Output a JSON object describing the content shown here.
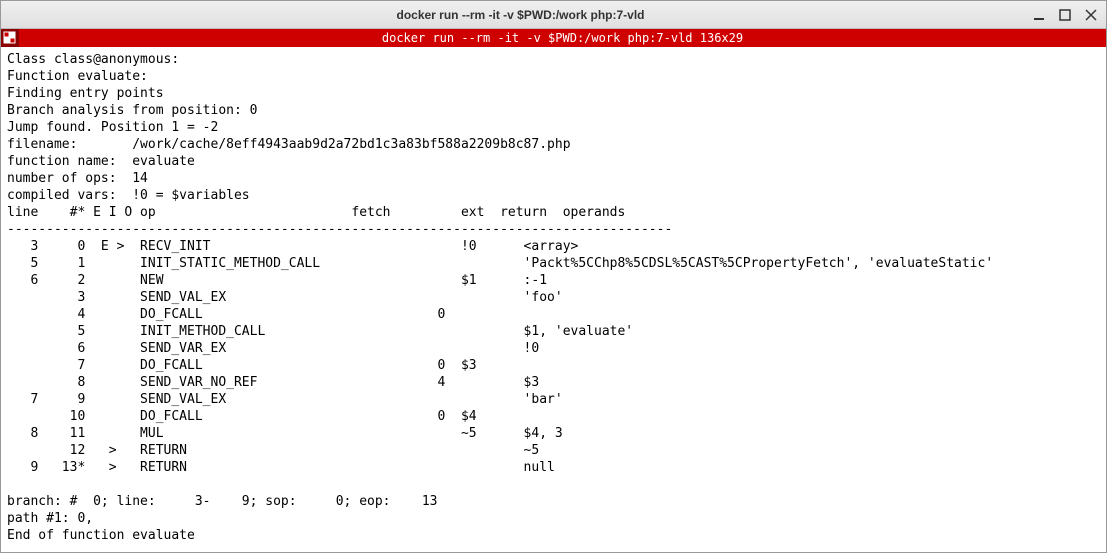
{
  "window": {
    "title": "docker run --rm -it -v $PWD:/work php:7-vld"
  },
  "redbar": {
    "title": "docker run --rm -it -v $PWD:/work php:7-vld 136x29"
  },
  "preamble": {
    "class_line": "Class class@anonymous:",
    "function_line": "Function evaluate:",
    "finding": "Finding entry points",
    "branch_analysis": "Branch analysis from position: 0",
    "jump_found": "Jump found. Position 1 = -2",
    "filename_label": "filename:",
    "filename_value": "/work/cache/8eff4943aab9d2a72bd1c3a83bf588a2209b8c87.php",
    "fn_name_label": "function name:",
    "fn_name_value": "evaluate",
    "num_ops_label": "number of ops:",
    "num_ops_value": "14",
    "compiled_vars_label": "compiled vars:",
    "compiled_vars_value": "!0 = $variables"
  },
  "header": {
    "line": "line",
    "num_eio": "#* E I O",
    "op": "op",
    "fetch": "fetch",
    "ext": "ext",
    "return": "return",
    "operands": "operands"
  },
  "dashes": "-------------------------------------------------------------------------------------",
  "rows": [
    {
      "line": "3",
      "idx": "0",
      "eio": "E >",
      "op": "RECV_INIT",
      "fetch": "",
      "ext": "",
      "ret": "!0",
      "operands": "<array>"
    },
    {
      "line": "5",
      "idx": "1",
      "eio": "",
      "op": "INIT_STATIC_METHOD_CALL",
      "fetch": "",
      "ext": "",
      "ret": "",
      "operands": "'Packt%5CChp8%5CDSL%5CAST%5CPropertyFetch', 'evaluateStatic'"
    },
    {
      "line": "6",
      "idx": "2",
      "eio": "",
      "op": "NEW",
      "fetch": "",
      "ext": "",
      "ret": "$1",
      "operands": ":-1"
    },
    {
      "line": "",
      "idx": "3",
      "eio": "",
      "op": "SEND_VAL_EX",
      "fetch": "",
      "ext": "",
      "ret": "",
      "operands": "'foo'"
    },
    {
      "line": "",
      "idx": "4",
      "eio": "",
      "op": "DO_FCALL",
      "fetch": "",
      "ext": "0",
      "ret": "",
      "operands": ""
    },
    {
      "line": "",
      "idx": "5",
      "eio": "",
      "op": "INIT_METHOD_CALL",
      "fetch": "",
      "ext": "",
      "ret": "",
      "operands": "$1, 'evaluate'"
    },
    {
      "line": "",
      "idx": "6",
      "eio": "",
      "op": "SEND_VAR_EX",
      "fetch": "",
      "ext": "",
      "ret": "",
      "operands": "!0"
    },
    {
      "line": "",
      "idx": "7",
      "eio": "",
      "op": "DO_FCALL",
      "fetch": "",
      "ext": "0",
      "ret": "$3",
      "operands": ""
    },
    {
      "line": "",
      "idx": "8",
      "eio": "",
      "op": "SEND_VAR_NO_REF",
      "fetch": "",
      "ext": "4",
      "ret": "",
      "operands": "$3"
    },
    {
      "line": "7",
      "idx": "9",
      "eio": "",
      "op": "SEND_VAL_EX",
      "fetch": "",
      "ext": "",
      "ret": "",
      "operands": "'bar'"
    },
    {
      "line": "",
      "idx": "10",
      "eio": "",
      "op": "DO_FCALL",
      "fetch": "",
      "ext": "0",
      "ret": "$4",
      "operands": ""
    },
    {
      "line": "8",
      "idx": "11",
      "eio": "",
      "op": "MUL",
      "fetch": "",
      "ext": "",
      "ret": "~5",
      "operands": "$4, 3"
    },
    {
      "line": "",
      "idx": "12",
      "eio": " >",
      "op": "RETURN",
      "fetch": "",
      "ext": "",
      "ret": "",
      "operands": "~5"
    },
    {
      "line": "9",
      "idx": "13*",
      "eio": " >",
      "op": "RETURN",
      "fetch": "",
      "ext": "",
      "ret": "",
      "operands": "null"
    }
  ],
  "footer": {
    "branch": "branch: #  0; line:     3-    9; sop:     0; eop:    13",
    "path": "path #1: 0,",
    "end": "End of function evaluate"
  }
}
